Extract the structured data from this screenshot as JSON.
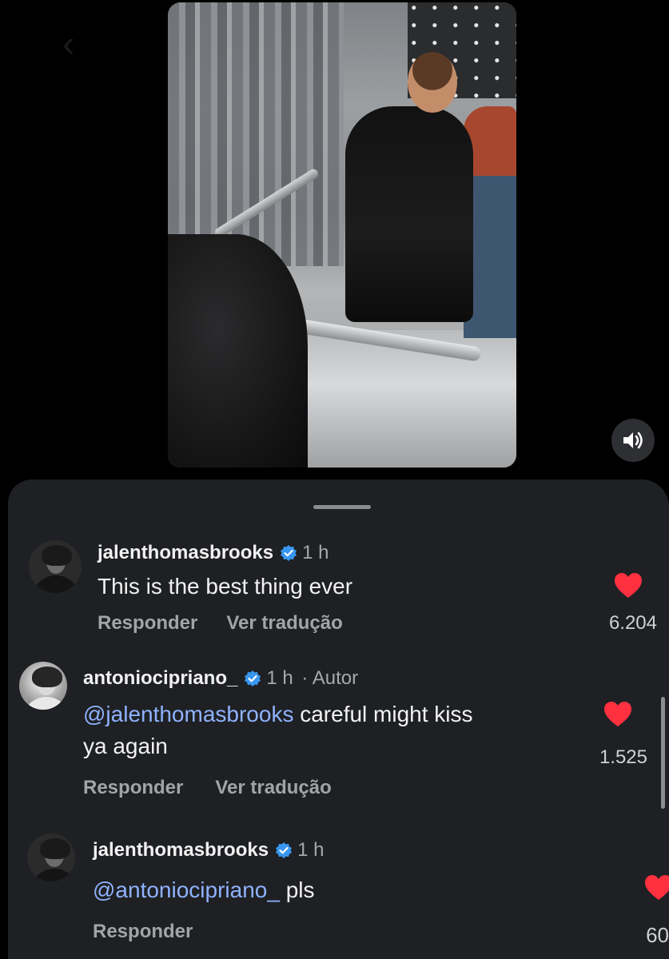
{
  "media": {
    "icons": {
      "back": "chevron-left-icon",
      "sound": "speaker-icon"
    }
  },
  "comments": [
    {
      "username": "jalenthomasbrooks",
      "verified": true,
      "time": "1 h",
      "author_tag": "",
      "mention": "",
      "text": "This is the best thing ever",
      "text_line2": "",
      "reply_label": "Responder",
      "translate_label": "Ver tradução",
      "likes": "6.204",
      "liked": true
    },
    {
      "username": "antoniocipriano_",
      "verified": true,
      "time": "1 h",
      "author_tag": "· Autor",
      "mention": "@jalenthomasbrooks",
      "text": " careful might kiss",
      "text_line2": "ya again",
      "reply_label": "Responder",
      "translate_label": "Ver tradução",
      "likes": "1.525",
      "liked": true
    },
    {
      "username": "jalenthomasbrooks",
      "verified": true,
      "time": "1 h",
      "author_tag": "",
      "mention": "@antoniocipriano_",
      "text": " pls",
      "text_line2": "",
      "reply_label": "Responder",
      "translate_label": "",
      "likes": "60",
      "liked": true
    }
  ],
  "colors": {
    "heart": "#ff3040",
    "verified": "#3897f0",
    "mention": "#8fb2ff",
    "sheet_bg": "#1e2023"
  }
}
